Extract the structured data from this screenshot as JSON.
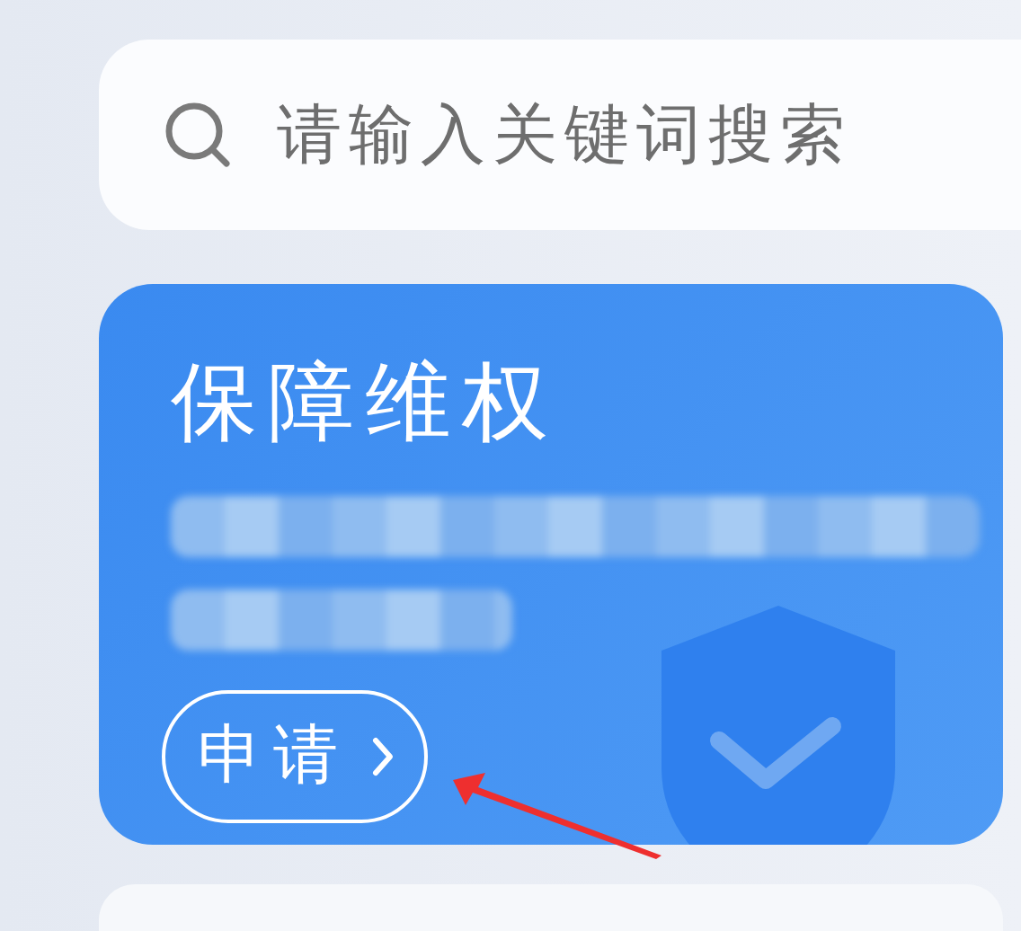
{
  "search": {
    "placeholder": "请输入关键词搜索"
  },
  "card": {
    "title": "保障维权",
    "button": "申请"
  }
}
